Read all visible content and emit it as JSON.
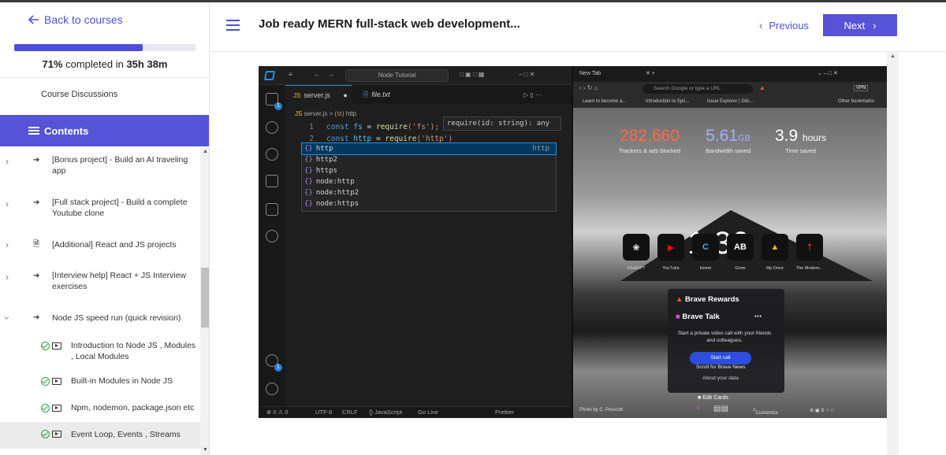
{
  "sidebar": {
    "back_label": "Back to courses",
    "progress": {
      "percent_value": 0.71,
      "percent_label": "71%",
      "middle": " completed in ",
      "time": "35h 38m"
    },
    "discussions_label": "Course Discussions",
    "contents_label": "Contents",
    "items": [
      {
        "label": "[Bonus project] - Build an AI traveling app",
        "icon": "chevron-right",
        "type": "project-icon"
      },
      {
        "label": "[Full stack project] - Build a complete Youtube clone",
        "icon": "chevron-right",
        "type": "project-icon"
      },
      {
        "label": "[Additional] React and JS projects",
        "icon": "chevron-right",
        "type": "document-icon"
      },
      {
        "label": "[Interview help] React + JS Interview exercises",
        "icon": "chevron-right",
        "type": "project-icon"
      },
      {
        "label": "Node JS speed run (quick revision)",
        "icon": "chevron-down",
        "type": "project-icon"
      }
    ],
    "lessons": [
      {
        "label": "Introduction to Node JS , Modules , Local Modules",
        "completed": true
      },
      {
        "label": "Built-in Modules in Node JS",
        "completed": true
      },
      {
        "label": "Npm, nodemon, package.json etc",
        "completed": true
      },
      {
        "label": "Event Loop, Events , Streams",
        "completed": true,
        "active": true
      }
    ]
  },
  "header": {
    "title": "Job ready MERN full-stack web development...",
    "previous_label": "Previous",
    "next_label": "Next"
  },
  "video": {
    "vscode": {
      "search": "Node Tutorial",
      "tabs": [
        "server.js",
        "file.txt"
      ],
      "breadcrumb_file": "server.js",
      "breadcrumb_symbol": "http",
      "code": {
        "line1_num": "1",
        "line1_kw": "const",
        "line1_var": "fs",
        "line1_eq": " = ",
        "line1_fn": "require",
        "line1_str": "('fs');",
        "line2_num": "2",
        "line2_kw": "const",
        "line2_var": "http",
        "line2_eq": " = ",
        "line2_fn": "require",
        "line2_str": "('http')"
      },
      "hint": "require(id: string): any",
      "suggestions": [
        {
          "label": "http",
          "detail": "http"
        },
        {
          "label": "http2",
          "detail": ""
        },
        {
          "label": "https",
          "detail": ""
        },
        {
          "label": "node:http",
          "detail": ""
        },
        {
          "label": "node:http2",
          "detail": ""
        },
        {
          "label": "node:https",
          "detail": ""
        }
      ],
      "status": {
        "errors": "⊗ 0 ⚠ 0",
        "encoding": "UTF-8",
        "eol": "CRLF",
        "lang": "{} JavaScript",
        "golive": "Go Live",
        "prettier": "Prettier"
      }
    },
    "browser": {
      "tab_label": "New Tab",
      "url_placeholder": "Search Google or type a URL",
      "vpn_label": "VPN",
      "bookmarks": [
        "Learn to become a...",
        "Introduction to Spri...",
        "Issue Explorer | Gitc..."
      ],
      "other_bookmarks": "Other bookmarks",
      "stats": [
        {
          "value": "282,660",
          "unit": "",
          "label": "Trackers & ads blocked"
        },
        {
          "value": "5.61",
          "unit": "GB",
          "label": "Bandwidth saved"
        },
        {
          "value": "3.9",
          "unit": "hours",
          "label": "Time saved"
        }
      ],
      "clock": "1:36",
      "shortcuts": [
        "ChatGPT",
        "YouTube",
        "Home",
        "Grow",
        "My Drive",
        "The Modern..."
      ],
      "rewards_title": "Brave Rewards",
      "talk_title": "Brave Talk",
      "talk_desc": "Start a private video call with your friends and colleagues.",
      "start_call": "Start call",
      "scroll_news": "Scroll for Brave News",
      "about_data": "About your data",
      "edit_cards": "Edit Cards",
      "photo_credit": "Photo by C. Prescott",
      "customize": "Customize"
    }
  }
}
